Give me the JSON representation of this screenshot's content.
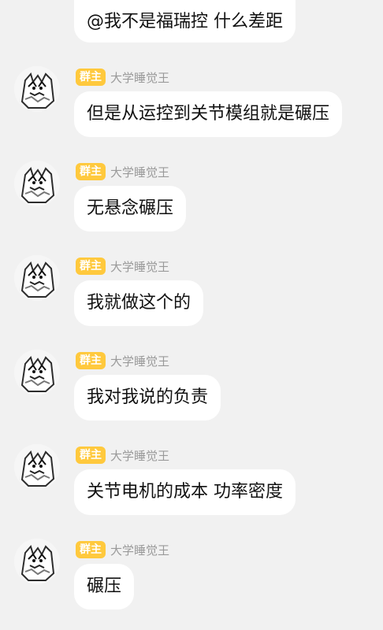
{
  "chat": {
    "top_message": "@我不是福瑞控 什么差距",
    "messages": [
      {
        "badge": "群主",
        "sender": "大学睡觉王",
        "text": "但是从运控到关节模组就是碾压"
      },
      {
        "badge": "群主",
        "sender": "大学睡觉王",
        "text": "无悬念碾压"
      },
      {
        "badge": "群主",
        "sender": "大学睡觉王",
        "text": "我就做这个的"
      },
      {
        "badge": "群主",
        "sender": "大学睡觉王",
        "text": "我对我说的负责"
      },
      {
        "badge": "群主",
        "sender": "大学睡觉王",
        "text": "关节电机的成本 功率密度"
      },
      {
        "badge": "群主",
        "sender": "大学睡觉王",
        "text": "碾压"
      }
    ]
  },
  "colors": {
    "background": "#f1f1f1",
    "bubble": "#ffffff",
    "badge": "#ffc93d",
    "sender_name": "#9a9a9a"
  },
  "icons": {
    "avatar": "wolf-sketch-avatar-icon"
  }
}
